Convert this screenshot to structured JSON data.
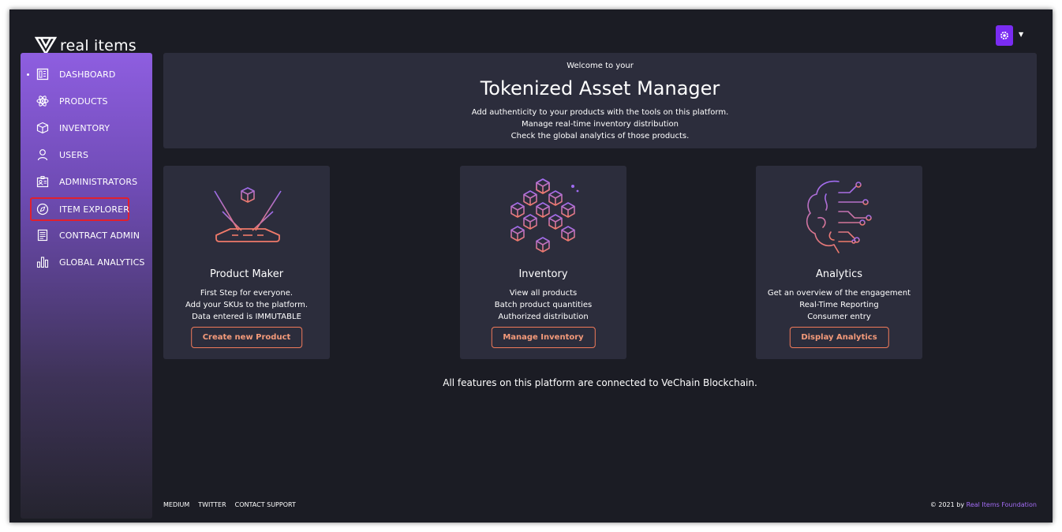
{
  "brand": {
    "name": "real items"
  },
  "sidebar": {
    "items": [
      {
        "label": "DASHBOARD",
        "icon": "dashboard-icon"
      },
      {
        "label": "PRODUCTS",
        "icon": "atom-icon"
      },
      {
        "label": "INVENTORY",
        "icon": "box-icon"
      },
      {
        "label": "USERS",
        "icon": "user-icon"
      },
      {
        "label": "ADMINISTRATORS",
        "icon": "admin-badge-icon"
      },
      {
        "label": "ITEM EXPLORER",
        "icon": "compass-icon"
      },
      {
        "label": "CONTRACT ADMIN",
        "icon": "document-icon"
      },
      {
        "label": "GLOBAL ANALYTICS",
        "icon": "bar-chart-icon"
      }
    ]
  },
  "welcome": {
    "pretitle": "Welcome to your",
    "title": "Tokenized Asset Manager",
    "lines": [
      "Add authenticity to your products with the tools on this platform.",
      "Manage real-time inventory distribution",
      "Check the global analytics of those products."
    ]
  },
  "cards": [
    {
      "title": "Product Maker",
      "lines": [
        "First Step for everyone.",
        "Add your SKUs to the platform.",
        "Data entered is IMMUTABLE"
      ],
      "button": "Create new Product",
      "icon": "product-maker-illustration-icon"
    },
    {
      "title": "Inventory",
      "lines": [
        "View all products",
        "Batch product quantities",
        "Authorized distribution"
      ],
      "button": "Manage Inventory",
      "icon": "inventory-cubes-illustration-icon"
    },
    {
      "title": "Analytics",
      "lines": [
        "Get an overview of the engagement",
        "Real-Time Reporting",
        "Consumer entry"
      ],
      "button": "Display Analytics",
      "icon": "brain-circuit-illustration-icon"
    }
  ],
  "tagline": "All features on this platform are connected to VeChain Blockchain.",
  "footer": {
    "links": [
      "MEDIUM",
      "TWITTER",
      "CONTACT SUPPORT"
    ],
    "copyright_prefix": "© 2021 by",
    "copyright_org": "Real Items Foundation"
  },
  "colors": {
    "background": "#1b1c24",
    "panel": "#2c2d3c",
    "accent": "#f07a5a",
    "brand_purple": "#7a2cf2",
    "highlight": "#e0202f"
  }
}
